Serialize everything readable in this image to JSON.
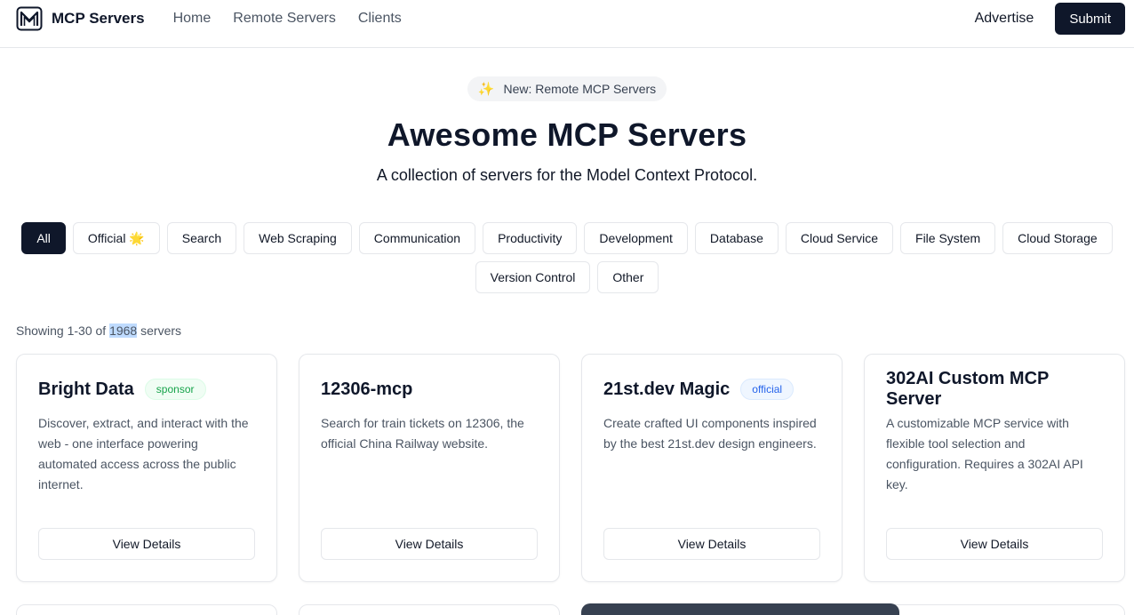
{
  "header": {
    "brand": "MCP Servers",
    "nav": [
      "Home",
      "Remote Servers",
      "Clients"
    ],
    "advertise": "Advertise",
    "submit": "Submit"
  },
  "hero": {
    "pill_icon": "sparkles-icon",
    "pill_text": "New: Remote MCP Servers",
    "title": "Awesome MCP Servers",
    "subtitle": "A collection of servers for the Model Context Protocol."
  },
  "filters": [
    {
      "label": "All",
      "active": true
    },
    {
      "label": "Official 🌟",
      "active": false
    },
    {
      "label": "Search",
      "active": false
    },
    {
      "label": "Web Scraping",
      "active": false
    },
    {
      "label": "Communication",
      "active": false
    },
    {
      "label": "Productivity",
      "active": false
    },
    {
      "label": "Development",
      "active": false
    },
    {
      "label": "Database",
      "active": false
    },
    {
      "label": "Cloud Service",
      "active": false
    },
    {
      "label": "File System",
      "active": false
    },
    {
      "label": "Cloud Storage",
      "active": false
    },
    {
      "label": "Version Control",
      "active": false
    },
    {
      "label": "Other",
      "active": false
    }
  ],
  "showing": {
    "prefix": "Showing 1-30 of ",
    "count": "1968",
    "suffix": " servers"
  },
  "cards": [
    {
      "title": "Bright Data",
      "badge": "sponsor",
      "description": "Discover, extract, and interact with the web - one interface powering automated access across the public internet.",
      "button": "View Details"
    },
    {
      "title": "12306-mcp",
      "badge": "",
      "description": "Search for train tickets on 12306, the official China Railway website.",
      "button": "View Details"
    },
    {
      "title": "21st.dev Magic",
      "badge": "official",
      "description": "Create crafted UI components inspired by the best 21st.dev design engineers.",
      "button": "View Details"
    },
    {
      "title": "302AI Custom MCP Server",
      "badge": "",
      "description": "A customizable MCP service with flexible tool selection and configuration. Requires a 302AI API key.",
      "button": "View Details"
    }
  ],
  "colors": {
    "primary": "#0f172a",
    "sponsor_badge": "#16a34a",
    "official_badge": "#2563eb",
    "highlight": "#bfdbfe"
  }
}
